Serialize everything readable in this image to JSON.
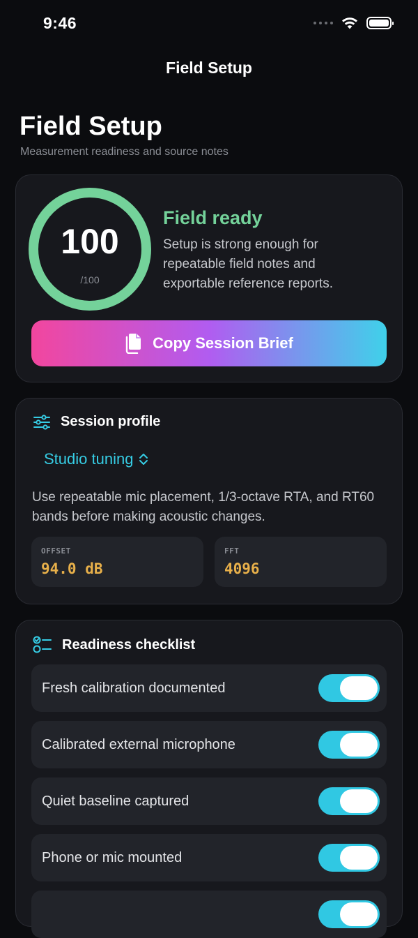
{
  "status_bar": {
    "time": "9:46"
  },
  "nav": {
    "title": "Field Setup"
  },
  "header": {
    "title": "Field Setup",
    "subtitle": "Measurement readiness and source notes"
  },
  "score_card": {
    "score": "100",
    "score_max": "/100",
    "score_fraction": 1.0,
    "ring_color": "#74d29a",
    "status_title": "Field ready",
    "status_description": "Setup is strong enough for repeatable field notes and exportable reference reports.",
    "copy_button_label": "Copy Session Brief",
    "copy_icon": "document-copy-icon"
  },
  "session_profile": {
    "icon": "sliders-icon",
    "title": "Session profile",
    "selected_profile": "Studio tuning",
    "description": "Use repeatable mic placement, 1/3-octave RTA, and RT60 bands before making acoustic changes.",
    "stats": [
      {
        "label": "OFFSET",
        "value": "94.0 dB"
      },
      {
        "label": "FFT",
        "value": "4096"
      }
    ]
  },
  "checklist": {
    "icon": "checklist-icon",
    "title": "Readiness checklist",
    "items": [
      {
        "label": "Fresh calibration documented",
        "enabled": true
      },
      {
        "label": "Calibrated external microphone",
        "enabled": true
      },
      {
        "label": "Quiet baseline captured",
        "enabled": true
      },
      {
        "label": "Phone or mic mounted",
        "enabled": true
      },
      {
        "label": "",
        "enabled": true
      }
    ]
  },
  "colors": {
    "accent_cyan": "#36cde5",
    "ready_green": "#74d29a",
    "stat_value": "#e8b04a",
    "gradient": [
      "#f2469e",
      "#b15cf0",
      "#3fd1ea"
    ]
  }
}
